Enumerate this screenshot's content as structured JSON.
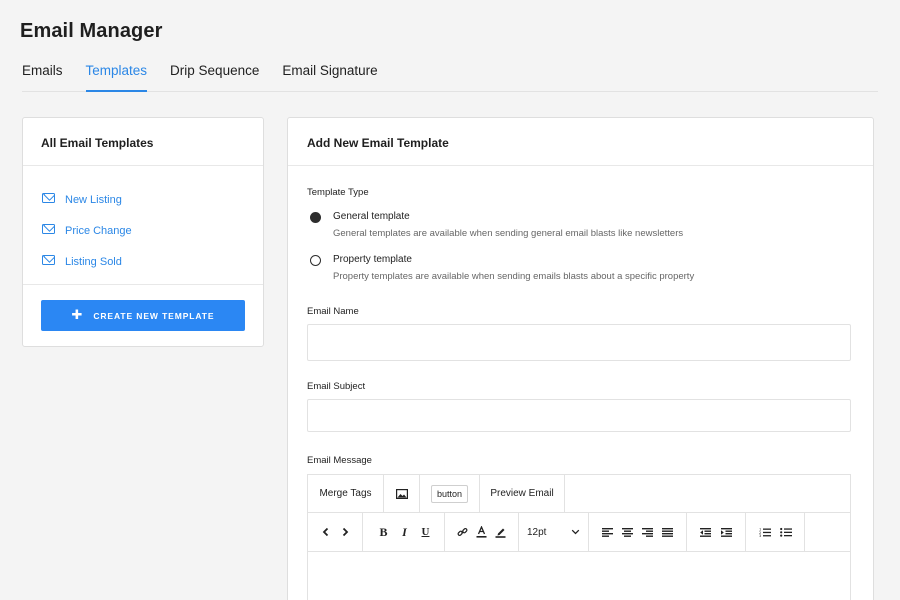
{
  "app": {
    "title": "Email Manager"
  },
  "tabs": [
    {
      "label": "Emails"
    },
    {
      "label": "Templates"
    },
    {
      "label": "Drip Sequence"
    },
    {
      "label": "Email Signature"
    }
  ],
  "left_panel": {
    "title": "All Email Templates",
    "templates": [
      {
        "label": "New Listing",
        "icon": "mail-icon"
      },
      {
        "label": "Price Change",
        "icon": "mail-icon"
      },
      {
        "label": "Listing Sold",
        "icon": "mail-icon"
      }
    ],
    "create_button": {
      "label": "CREATE NEW TEMPLATE",
      "icon": "plus-icon"
    }
  },
  "form": {
    "title": "Add New Email Template",
    "template_type_label": "Template Type",
    "options": [
      {
        "title": "General template",
        "description": "General templates are available when sending general email blasts like newsletters",
        "selected": true
      },
      {
        "title": "Property template",
        "description": "Property templates are available when sending emails blasts about a specific property",
        "selected": false
      }
    ],
    "email_name_label": "Email Name",
    "email_name_value": "",
    "email_subject_label": "Email Subject",
    "email_subject_value": "",
    "email_message_label": "Email Message",
    "editor": {
      "merge_tags_label": "Merge Tags",
      "button_label": "button",
      "preview_label": "Preview Email",
      "font_size": "12pt",
      "bold_glyph": "B",
      "italic_glyph": "I",
      "underline_glyph": "U"
    }
  },
  "colors": {
    "accent": "#2b87e6",
    "button": "#2b87f3"
  }
}
